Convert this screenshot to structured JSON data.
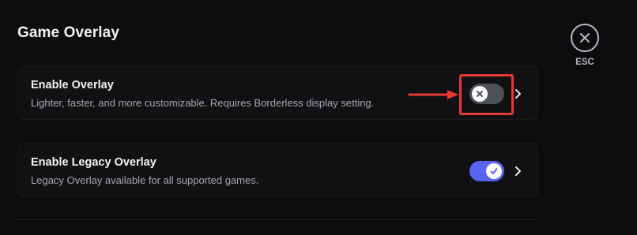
{
  "page": {
    "title": "Game Overlay"
  },
  "close": {
    "label": "ESC",
    "icon": "close-icon"
  },
  "settings": [
    {
      "title": "Enable Overlay",
      "description": "Lighter, faster, and more customizable. Requires Borderless display setting.",
      "enabled": false,
      "toggle_icon": "x-icon",
      "chevron_icon": "chevron-right-icon"
    },
    {
      "title": "Enable Legacy Overlay",
      "description": "Legacy Overlay available for all supported games.",
      "enabled": true,
      "toggle_icon": "check-icon",
      "chevron_icon": "chevron-right-icon"
    }
  ],
  "annotation": {
    "highlight_color": "#e53935"
  },
  "colors": {
    "background": "#0c0c0e",
    "card": "#111114",
    "toggle_off": "#4e5058",
    "toggle_on": "#5865f2"
  }
}
